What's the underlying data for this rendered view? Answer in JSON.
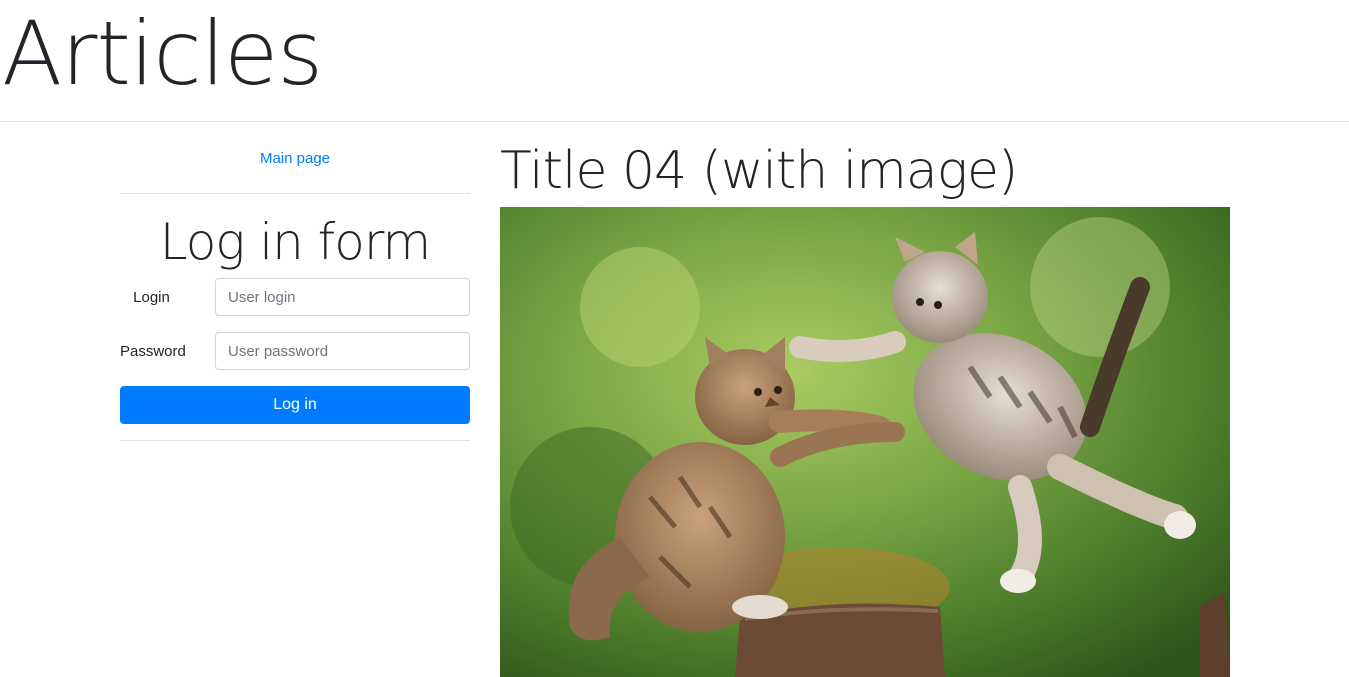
{
  "header": {
    "title": "Articles"
  },
  "sidebar": {
    "nav_link": "Main page",
    "form": {
      "title": "Log in form",
      "login_label": "Login",
      "login_placeholder": "User login",
      "password_label": "Password",
      "password_placeholder": "User password",
      "submit_label": "Log in"
    }
  },
  "article": {
    "title": "Title 04 (with image)",
    "image_icon": "kittens-image"
  },
  "colors": {
    "primary": "#007bff",
    "text": "#212529",
    "border": "#dee2e6"
  }
}
